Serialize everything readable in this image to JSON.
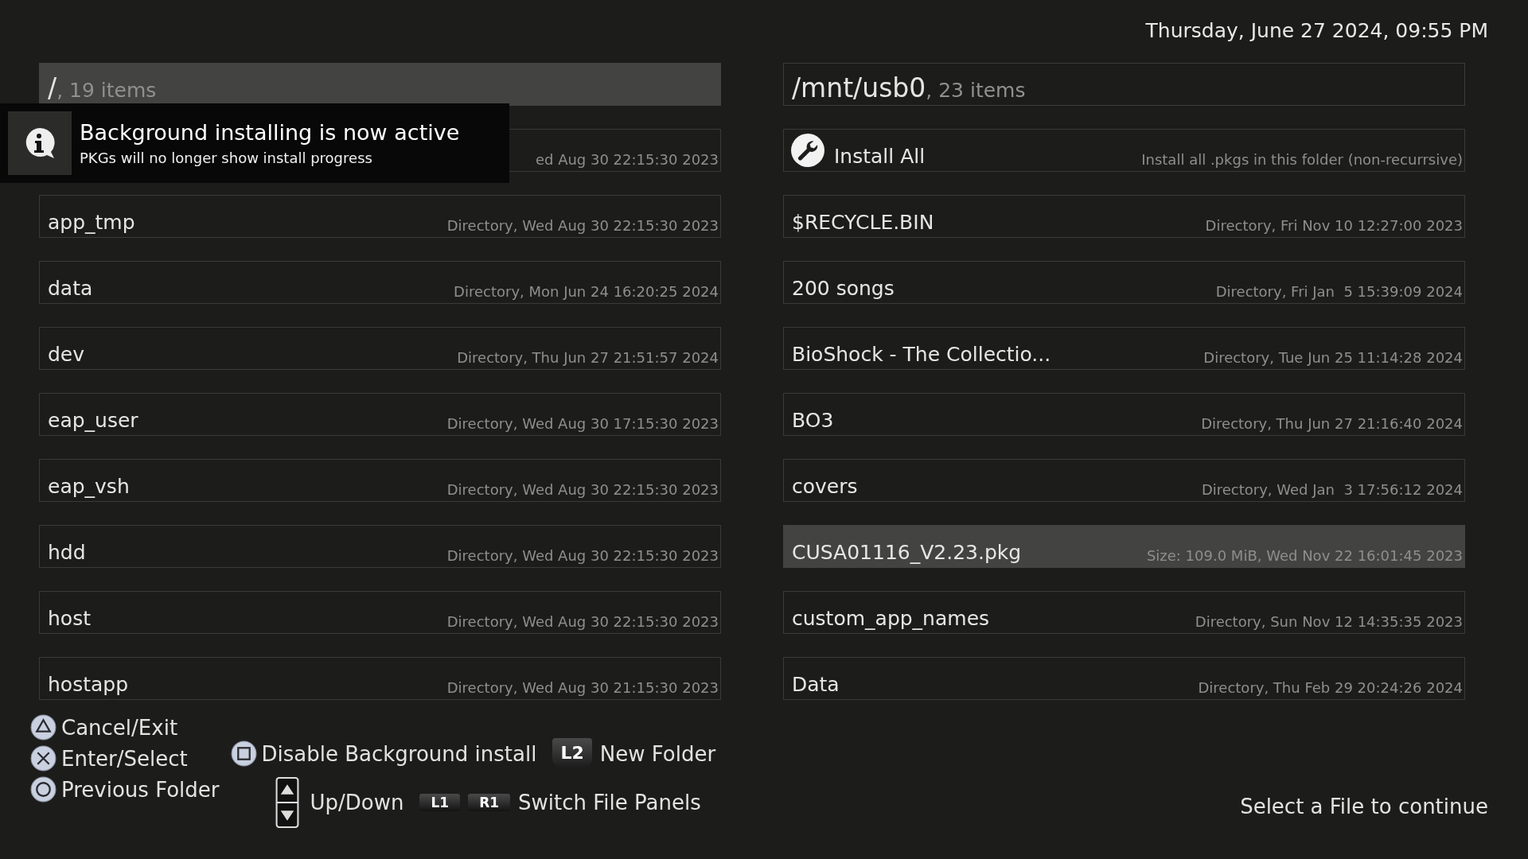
{
  "datetime": "Thursday, June 27 2024, 09:55 PM",
  "panels": [
    {
      "path": "/",
      "count": ", 19 items",
      "active": true,
      "rows": [
        {
          "kind": "entry",
          "detail": "ed Aug 30 22:15:30 2023",
          "selected": false
        },
        {
          "kind": "entry",
          "name": "app_tmp",
          "detail": "Directory, Wed Aug 30 22:15:30 2023",
          "selected": false
        },
        {
          "kind": "entry",
          "name": "data",
          "detail": "Directory, Mon Jun 24 16:20:25 2024",
          "selected": false
        },
        {
          "kind": "entry",
          "name": "dev",
          "detail": "Directory, Thu Jun 27 21:51:57 2024",
          "selected": false
        },
        {
          "kind": "entry",
          "name": "eap_user",
          "detail": "Directory, Wed Aug 30 17:15:30 2023",
          "selected": false
        },
        {
          "kind": "entry",
          "name": "eap_vsh",
          "detail": "Directory, Wed Aug 30 22:15:30 2023",
          "selected": false
        },
        {
          "kind": "entry",
          "name": "hdd",
          "detail": "Directory, Wed Aug 30 22:15:30 2023",
          "selected": false
        },
        {
          "kind": "entry",
          "name": "host",
          "detail": "Directory, Wed Aug 30 22:15:30 2023",
          "selected": false
        },
        {
          "kind": "entry",
          "name": "hostapp",
          "detail": "Directory, Wed Aug 30 21:15:30 2023",
          "selected": false
        }
      ]
    },
    {
      "path": "/mnt/usb0",
      "count": ", 23 items",
      "active": false,
      "rows": [
        {
          "kind": "action",
          "name": "Install All",
          "detail": "Install all .pkgs in this folder (non-recurrsive)",
          "selected": false
        },
        {
          "kind": "entry",
          "name": "$RECYCLE.BIN",
          "detail": "Directory, Fri Nov 10 12:27:00 2023",
          "selected": false
        },
        {
          "kind": "entry",
          "name": "200 songs",
          "detail": "Directory, Fri Jan  5 15:39:09 2024",
          "selected": false
        },
        {
          "kind": "entry",
          "name": "BioShock - The Collectio...",
          "detail": "Directory, Tue Jun 25 11:14:28 2024",
          "selected": false
        },
        {
          "kind": "entry",
          "name": "BO3",
          "detail": "Directory, Thu Jun 27 21:16:40 2024",
          "selected": false
        },
        {
          "kind": "entry",
          "name": "covers",
          "detail": "Directory, Wed Jan  3 17:56:12 2024",
          "selected": false
        },
        {
          "kind": "entry",
          "name": "CUSA01116_V2.23.pkg",
          "detail": "Size: 109.0 MiB, Wed Nov 22 16:01:45 2023",
          "selected": true
        },
        {
          "kind": "entry",
          "name": "custom_app_names",
          "detail": "Directory, Sun Nov 12 14:35:35 2023",
          "selected": false
        },
        {
          "kind": "entry",
          "name": "Data",
          "detail": "Directory, Thu Feb 29 20:24:26 2024",
          "selected": false
        }
      ]
    }
  ],
  "toast": {
    "title": "Background installing is now active",
    "message": "PKGs will no longer show install progress"
  },
  "legend": {
    "column_1": [
      {
        "kind": "triangle",
        "label": "Cancel/Exit"
      },
      {
        "kind": "cross",
        "label": "Enter/Select"
      },
      {
        "kind": "circle",
        "label": "Previous Folder"
      }
    ],
    "column_2": [
      [
        {
          "keys": [
            {
              "kind": "square"
            }
          ],
          "label": "Disable Background install"
        },
        {
          "keys": [
            {
              "kind": "trigger",
              "label": "L2"
            }
          ],
          "label": "New Folder"
        }
      ],
      [
        {
          "keys": [
            {
              "kind": "updown"
            }
          ],
          "label": "Up/Down"
        },
        {
          "keys": [
            {
              "kind": "bumper",
              "label": "L1"
            },
            {
              "kind": "bumper",
              "label": "R1"
            }
          ],
          "label": "Switch File Panels"
        }
      ]
    ]
  },
  "status": "Select a File to continue"
}
